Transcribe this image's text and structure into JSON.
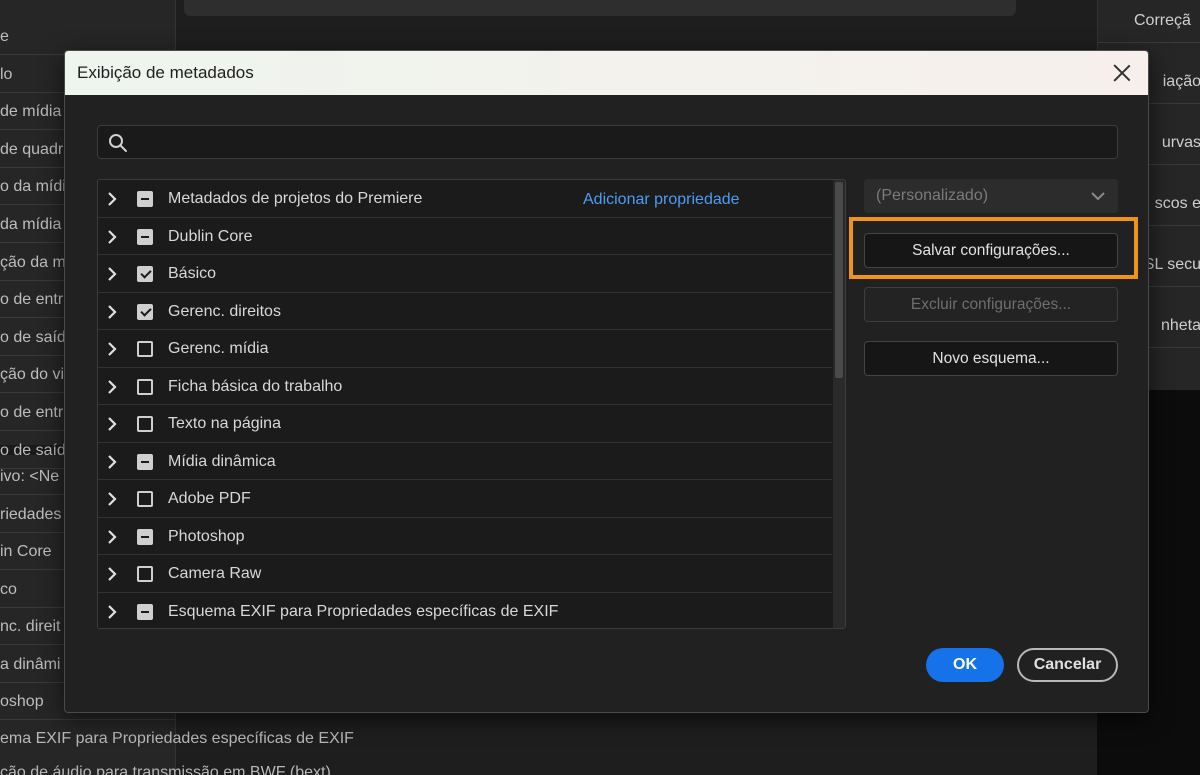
{
  "background": {
    "left_items": [
      "e",
      "lo",
      "de mídia",
      "de quadr",
      "o da mídi",
      "da mídia",
      "ção da m",
      "o de entr",
      "o de saíd",
      "ção do vi",
      "o de entr",
      "o de saíd"
    ],
    "left_lower_items": [
      "ivo: <Ne",
      "riedades",
      "in Core",
      "co",
      "nc. direit",
      "a dinâmi",
      "oshop"
    ],
    "bottom_items": [
      "ema EXIF para Propriedades específicas de EXIF",
      "ção de áudio para transmissão em BWF (bext)"
    ],
    "right_items": [
      "Correçã",
      "iação",
      "urvas",
      "scos e",
      "SL secu",
      "nheta"
    ]
  },
  "dialog": {
    "title": "Exibição de metadados",
    "search": {
      "placeholder": "",
      "value": ""
    },
    "add_property_label": "Adicionar propriedade",
    "rows": [
      {
        "label": "Metadados de projetos do Premiere",
        "state": "mixed"
      },
      {
        "label": "Dublin Core",
        "state": "mixed"
      },
      {
        "label": "Básico",
        "state": "checked"
      },
      {
        "label": "Gerenc. direitos",
        "state": "checked"
      },
      {
        "label": "Gerenc. mídia",
        "state": "unchecked"
      },
      {
        "label": "Ficha básica do trabalho",
        "state": "unchecked"
      },
      {
        "label": "Texto na página",
        "state": "unchecked"
      },
      {
        "label": "Mídia dinâmica",
        "state": "mixed"
      },
      {
        "label": "Adobe PDF",
        "state": "unchecked"
      },
      {
        "label": "Photoshop",
        "state": "mixed"
      },
      {
        "label": "Camera Raw",
        "state": "unchecked"
      },
      {
        "label": "Esquema EXIF para Propriedades específicas de EXIF",
        "state": "mixed"
      }
    ],
    "preset": {
      "selected": "(Personalizado)"
    },
    "buttons": {
      "save": "Salvar configurações...",
      "delete": "Excluir configurações...",
      "new_schema": "Novo esquema...",
      "ok": "OK",
      "cancel": "Cancelar"
    }
  },
  "colors": {
    "accent": "#1572e8",
    "highlight": "#f0931d",
    "link": "#4b9cf5"
  }
}
